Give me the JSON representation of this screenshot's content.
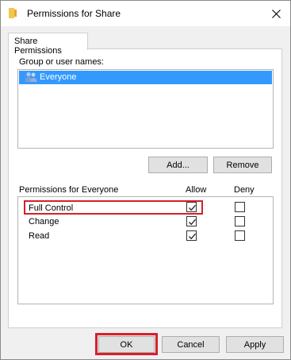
{
  "window": {
    "title": "Permissions for Share",
    "close_label": "✕"
  },
  "tabs": [
    {
      "label": "Share Permissions",
      "active": true
    }
  ],
  "group_section": {
    "label": "Group or user names:",
    "users": [
      {
        "name": "Everyone",
        "selected": true,
        "icon": "users-group-icon"
      }
    ]
  },
  "user_buttons": {
    "add_label": "Add...",
    "remove_label": "Remove"
  },
  "permissions_section": {
    "label": "Permissions for Everyone",
    "allow_header": "Allow",
    "deny_header": "Deny",
    "rows": [
      {
        "name": "Full Control",
        "allow": true,
        "deny": false,
        "highlighted": true
      },
      {
        "name": "Change",
        "allow": true,
        "deny": false,
        "highlighted": false
      },
      {
        "name": "Read",
        "allow": true,
        "deny": false,
        "highlighted": false
      }
    ]
  },
  "footer": {
    "ok_label": "OK",
    "cancel_label": "Cancel",
    "apply_label": "Apply"
  },
  "colors": {
    "selection": "#3399ff",
    "highlight": "#d6202c",
    "folder": "#f3c74d"
  }
}
